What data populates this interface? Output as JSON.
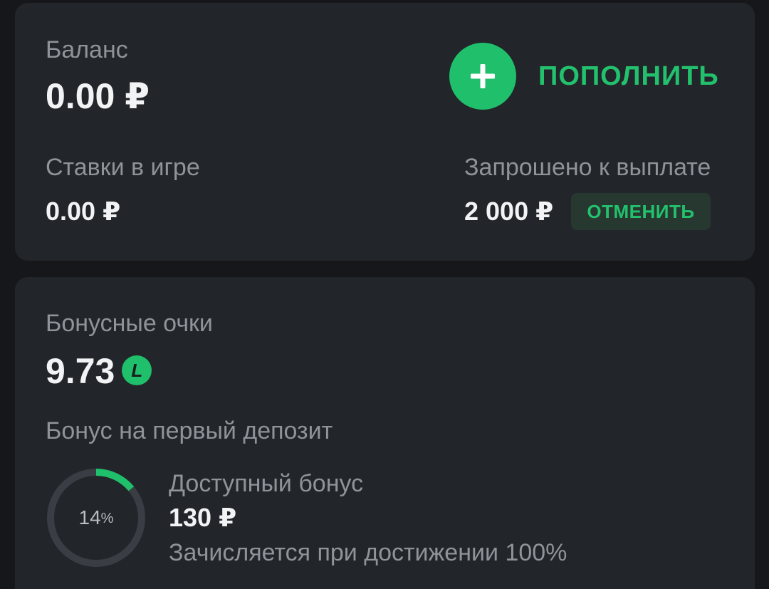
{
  "balance": {
    "label": "Баланс",
    "amount": "0.00 ₽",
    "topup_label": "ПОПОЛНИТЬ",
    "bets_label": "Ставки в игре",
    "bets_amount": "0.00 ₽",
    "payout_label": "Запрошено к выплате",
    "payout_amount": "2 000 ₽",
    "cancel_label": "ОТМЕНИТЬ"
  },
  "bonus": {
    "points_label": "Бонусные очки",
    "points_value": "9.73",
    "coin_letter": "L",
    "first_deposit_label": "Бонус на первый депозит",
    "progress_value": "14",
    "progress_unit": "%",
    "progress_fraction": 0.14,
    "available_label": "Доступный бонус",
    "available_amount": "130 ₽",
    "note": "Зачисляется при достижении 100%"
  },
  "colors": {
    "background": "#15171a",
    "card": "#222529",
    "accent": "#1fbf6b",
    "text_primary": "#f2f3f5",
    "text_secondary": "#8f949a",
    "ring_track": "#3a3e44"
  },
  "icons": {
    "topup": "plus-icon",
    "bonus_coin": "bonus-coin-icon"
  }
}
